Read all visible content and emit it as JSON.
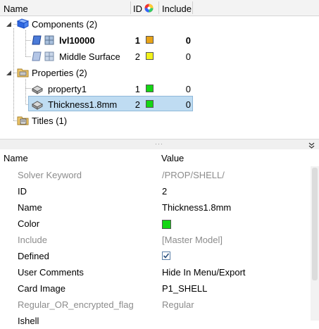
{
  "tree": {
    "columns": {
      "name": "Name",
      "id": "ID",
      "include": "Include"
    },
    "nodes": [
      {
        "label": "Components (2)",
        "kind": "folder"
      },
      {
        "label": "lvl10000",
        "id": "1",
        "include": "0",
        "color": "#e8a317",
        "bold": true
      },
      {
        "label": "Middle Surface",
        "id": "2",
        "include": "0",
        "color": "#f2f21a"
      },
      {
        "label": "Properties (2)",
        "kind": "folder"
      },
      {
        "label": "property1",
        "id": "1",
        "include": "0",
        "color": "#13d613"
      },
      {
        "label": "Thickness1.8mm",
        "id": "2",
        "include": "0",
        "color": "#13d613",
        "selected": true
      },
      {
        "label": "Titles (1)",
        "kind": "folder"
      }
    ]
  },
  "properties": {
    "columns": {
      "name": "Name",
      "value": "Value"
    },
    "rows": [
      {
        "name": "Solver Keyword",
        "value": "/PROP/SHELL/",
        "dim": true
      },
      {
        "name": "ID",
        "value": "2"
      },
      {
        "name": "Name",
        "value": "Thickness1.8mm"
      },
      {
        "name": "Color",
        "value": "",
        "color": "#13d613"
      },
      {
        "name": "Include",
        "value": "[Master Model]",
        "dim": true
      },
      {
        "name": "Defined",
        "value": "",
        "checked": true
      },
      {
        "name": "User Comments",
        "value": "Hide In Menu/Export"
      },
      {
        "name": "Card Image",
        "value": "P1_SHELL"
      },
      {
        "name": "Regular_OR_encrypted_flag",
        "value": "Regular",
        "dim": true
      },
      {
        "name": "Ishell",
        "value": ""
      }
    ]
  }
}
